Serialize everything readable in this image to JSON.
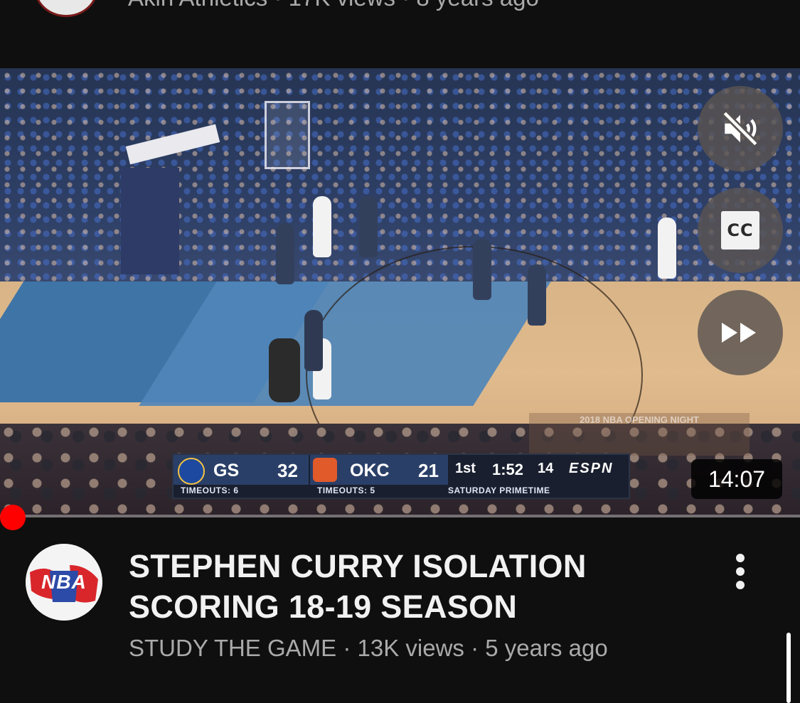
{
  "previous_item": {
    "channel": "Akin Athletics",
    "views": "17K views",
    "age": "8 years ago",
    "separator": "·"
  },
  "player": {
    "duration": "14:07",
    "controls": {
      "mute_icon": "volume-muted-icon",
      "captions_label": "CC",
      "forward_icon": "fast-forward-icon"
    },
    "scorebug": {
      "home_team": "GS",
      "home_score": "32",
      "home_timeouts": "TIMEOUTS: 6",
      "away_team": "OKC",
      "away_score": "21",
      "away_timeouts": "TIMEOUTS: 5",
      "period": "1st",
      "clock": "1:52",
      "shot_clock": "14",
      "network": "ESPN",
      "subtitle": "SATURDAY PRIMETIME"
    },
    "overlay_text": "2018 NBA OPENING NIGHT",
    "watched_fraction": 0.0
  },
  "video": {
    "title": "STEPHEN CURRY ISOLATION SCORING 18-19 SEASON",
    "channel": "STUDY THE GAME",
    "views": "13K views",
    "age": "5 years ago",
    "separator": "·",
    "channel_avatar_text": "NBA"
  },
  "colors": {
    "background": "#0f0f0f",
    "progress": "#ff0000",
    "text_primary": "#f1f1f1",
    "text_secondary": "#aaaaaa"
  }
}
